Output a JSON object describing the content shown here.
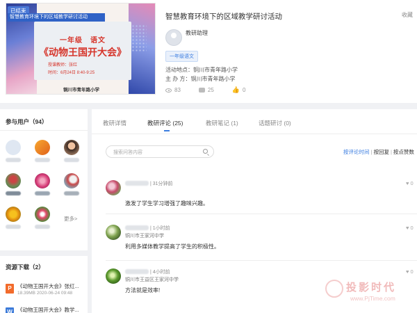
{
  "activity": {
    "status_badge": "已结束",
    "cover_banner": "智慧教育环境下的区域教学研讨活动",
    "cover_grade": "一年级　语文",
    "cover_title": "《动物王国开大会》",
    "cover_teacher": "授课教师：张红",
    "cover_time": "时间：6月24日 8:40-9:25",
    "cover_school": "铜川市青年路小学",
    "title": "智慧教育环境下的区域教学研讨活动",
    "favorite_label": "收藏",
    "assistant_name": "教研助理",
    "grade_tag": "一年级语文",
    "location_key": "活动地点：",
    "location_value": "铜川市青年路小学",
    "organizer_key": "主 办 方：",
    "organizer_value": "铜川市青年路小学",
    "views": "83",
    "comments": "25",
    "likes": "0"
  },
  "users_panel": {
    "title": "参与用户（94）",
    "more_label": "更多>"
  },
  "resources": {
    "title": "资源下载（2）",
    "items": [
      {
        "name": "《动物王国开大会》张红...",
        "meta": "18.39MB 2020-06-24 09:48",
        "type": "P"
      },
      {
        "name": "《动物王国开大会》教学...",
        "meta": "",
        "type": "W"
      }
    ]
  },
  "tabs": [
    {
      "label": "教研详情"
    },
    {
      "label": "教研评论 (25)"
    },
    {
      "label": "教研笔记 (1)"
    },
    {
      "label": "话题研讨 (0)"
    }
  ],
  "search": {
    "placeholder": "搜索问答内容"
  },
  "sort": {
    "by_time": "按评论时间",
    "by_reply": "按回复",
    "by_like": "按点赞数",
    "sep": "|"
  },
  "comments": [
    {
      "time": "| 31分钟前",
      "school": "",
      "text": "激发了学生学习增强了趣味兴趣。",
      "likes": "0"
    },
    {
      "time": "| 1小时前",
      "school": "铜川市王家河中学",
      "text": "利用多媒体教学提高了学生的积极性。",
      "likes": "0"
    },
    {
      "time": "| 4小时前",
      "school": "铜川市王益区王家河中学",
      "text": "方法就是效率!",
      "likes": "0"
    }
  ],
  "watermark": {
    "text": "投影时代",
    "url": "www.PjTime.com"
  },
  "colors": {
    "accent": "#3b7de0",
    "cover_red": "#d6352b",
    "ppt_orange": "#f26b2b"
  }
}
